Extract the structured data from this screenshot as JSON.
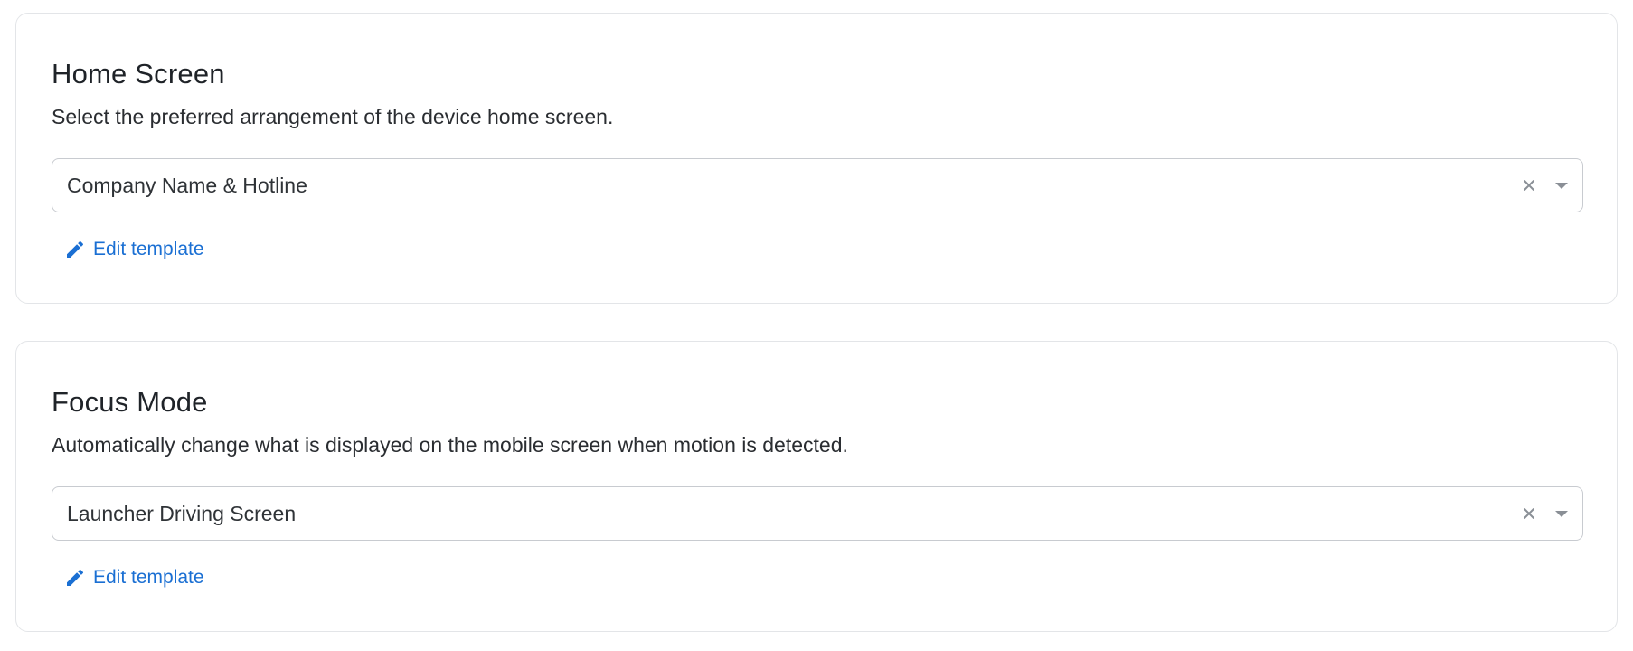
{
  "sections": [
    {
      "title": "Home Screen",
      "description": "Select the preferred arrangement of the device home screen.",
      "select": {
        "value": "Company Name & Hotline",
        "clear_icon": "close-icon",
        "dropdown_icon": "chevron-down-icon"
      },
      "edit_link": {
        "label": "Edit template",
        "icon": "pencil-icon"
      }
    },
    {
      "title": "Focus Mode",
      "description": "Automatically change what is displayed on the mobile screen when motion is detected.",
      "select": {
        "value": "Launcher Driving Screen",
        "clear_icon": "close-icon",
        "dropdown_icon": "chevron-down-icon"
      },
      "edit_link": {
        "label": "Edit template",
        "icon": "pencil-icon"
      }
    }
  ],
  "colors": {
    "link": "#1a6fd3",
    "border": "#c8cbd0",
    "card_border": "#e3e5e8",
    "icon_gray": "#8a8f96"
  }
}
